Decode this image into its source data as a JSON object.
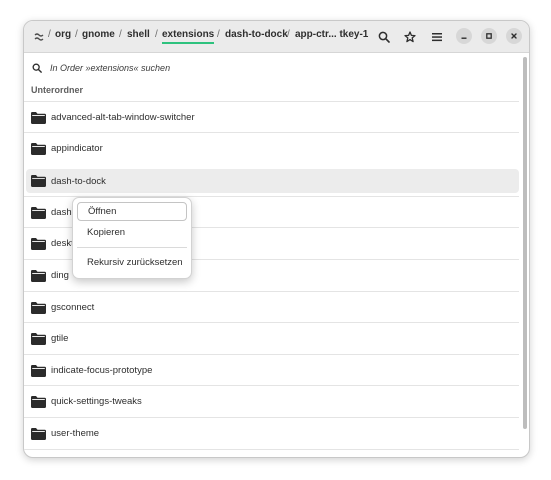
{
  "header": {
    "breadcrumb": [
      "org",
      "gnome",
      "shell",
      "extensions",
      "dash-to-dock",
      "app-ctr... tkey-1"
    ],
    "separator": "/",
    "active_index": 3
  },
  "search": {
    "placeholder": "In Order »extensions« suchen"
  },
  "section_title": "Unterordner",
  "folders": [
    "advanced-alt-tab-window-switcher",
    "appindicator",
    "dash-to-dock",
    "dash-",
    "deskt",
    "ding",
    "gsconnect",
    "gtile",
    "indicate-focus-prototype",
    "quick-settings-tweaks",
    "user-theme"
  ],
  "context_menu": {
    "open": "Öffnen",
    "copy": "Kopieren",
    "reset": "Rekursiv zurücksetzen"
  },
  "icons": {
    "app": "dconf-icon",
    "search": "search-icon",
    "bookmark": "star-icon",
    "menu": "hamburger-menu-icon",
    "minimize": "minimize-icon",
    "maximize": "maximize-icon",
    "close": "close-icon",
    "folder": "folder-icon"
  },
  "colors": {
    "accent": "#2ec27e"
  }
}
